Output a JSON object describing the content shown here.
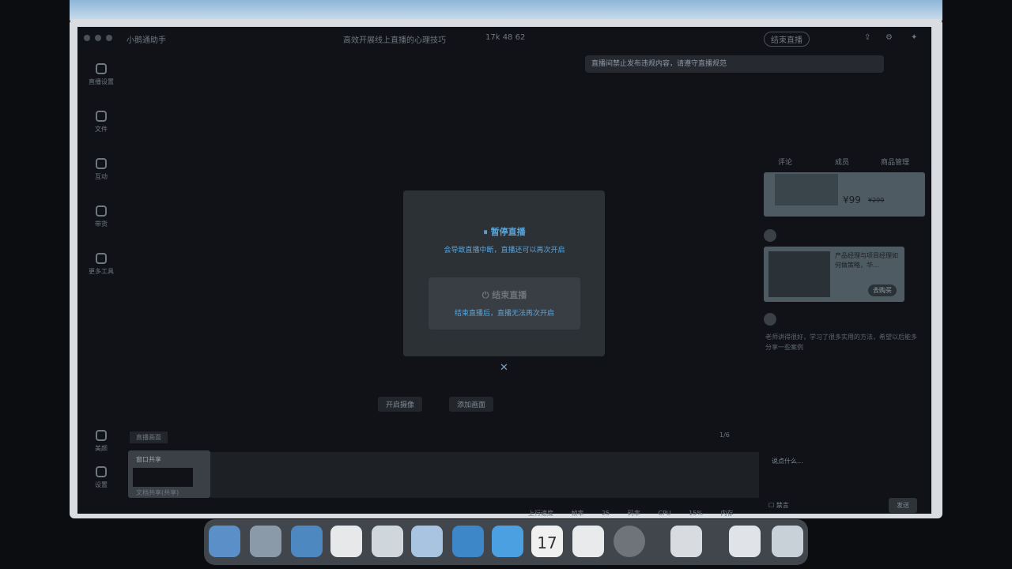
{
  "app": {
    "name": "小鹅通助手",
    "live_title": "高效开展线上直播的心理技巧",
    "stats": "17k  48  62",
    "end_button": "结束直播"
  },
  "banner": "直播间禁止发布违规内容，请遵守直播规范",
  "sidebar": [
    {
      "label": "直播设置",
      "icon": "gear-icon"
    },
    {
      "label": "文件",
      "icon": "folder-icon"
    },
    {
      "label": "互动",
      "icon": "chat-icon"
    },
    {
      "label": "带货",
      "icon": "bag-icon"
    },
    {
      "label": "更多工具",
      "icon": "toolbox-icon"
    },
    {
      "label": "美颜",
      "icon": "beauty-icon"
    },
    {
      "label": "设置",
      "icon": "settings-icon"
    }
  ],
  "dialog": {
    "pause": {
      "title": "暂停直播",
      "desc": "会导致直播中断，直播还可以再次开启"
    },
    "end": {
      "title": "结束直播",
      "desc": "结束直播后，直播无法再次开启"
    }
  },
  "center_buttons": [
    "开启摄像",
    "添加画面"
  ],
  "scene": {
    "label": "直播画面",
    "item": "窗口共享",
    "item_caption": "文档共享(共享)",
    "count": "1/6"
  },
  "status_bar": [
    "上行速度",
    "帧率 25",
    "码率",
    "CPU 15%",
    "内存"
  ],
  "right": {
    "tabs": [
      "评论",
      "成员",
      "商品管理"
    ],
    "product_price": "¥99",
    "product_original": "¥299",
    "course_title": "产品经理与项目经理如何做策略，华...",
    "course_button": "去购买",
    "comment": "老师讲得很好，学习了很多实用的方法，希望以后能多分享一些案例",
    "input_placeholder": "说点什么...",
    "mute_label": "禁言",
    "send": "发送"
  },
  "dock": [
    "Finder",
    "Chrome",
    "Safari",
    "WPS",
    "WeChat",
    "Feishu",
    "Lark",
    "QQ",
    "17",
    "Tasks",
    "Photos",
    "Preview",
    "Contacts",
    "Trash"
  ]
}
